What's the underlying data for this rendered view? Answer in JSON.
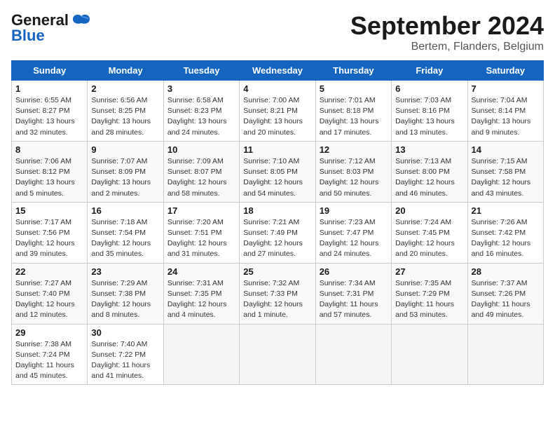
{
  "header": {
    "logo_line1": "General",
    "logo_line2": "Blue",
    "title": "September 2024",
    "subtitle": "Bertem, Flanders, Belgium"
  },
  "weekdays": [
    "Sunday",
    "Monday",
    "Tuesday",
    "Wednesday",
    "Thursday",
    "Friday",
    "Saturday"
  ],
  "weeks": [
    [
      {
        "day": 1,
        "info": "Sunrise: 6:55 AM\nSunset: 8:27 PM\nDaylight: 13 hours\nand 32 minutes."
      },
      {
        "day": 2,
        "info": "Sunrise: 6:56 AM\nSunset: 8:25 PM\nDaylight: 13 hours\nand 28 minutes."
      },
      {
        "day": 3,
        "info": "Sunrise: 6:58 AM\nSunset: 8:23 PM\nDaylight: 13 hours\nand 24 minutes."
      },
      {
        "day": 4,
        "info": "Sunrise: 7:00 AM\nSunset: 8:21 PM\nDaylight: 13 hours\nand 20 minutes."
      },
      {
        "day": 5,
        "info": "Sunrise: 7:01 AM\nSunset: 8:18 PM\nDaylight: 13 hours\nand 17 minutes."
      },
      {
        "day": 6,
        "info": "Sunrise: 7:03 AM\nSunset: 8:16 PM\nDaylight: 13 hours\nand 13 minutes."
      },
      {
        "day": 7,
        "info": "Sunrise: 7:04 AM\nSunset: 8:14 PM\nDaylight: 13 hours\nand 9 minutes."
      }
    ],
    [
      {
        "day": 8,
        "info": "Sunrise: 7:06 AM\nSunset: 8:12 PM\nDaylight: 13 hours\nand 5 minutes."
      },
      {
        "day": 9,
        "info": "Sunrise: 7:07 AM\nSunset: 8:09 PM\nDaylight: 13 hours\nand 2 minutes."
      },
      {
        "day": 10,
        "info": "Sunrise: 7:09 AM\nSunset: 8:07 PM\nDaylight: 12 hours\nand 58 minutes."
      },
      {
        "day": 11,
        "info": "Sunrise: 7:10 AM\nSunset: 8:05 PM\nDaylight: 12 hours\nand 54 minutes."
      },
      {
        "day": 12,
        "info": "Sunrise: 7:12 AM\nSunset: 8:03 PM\nDaylight: 12 hours\nand 50 minutes."
      },
      {
        "day": 13,
        "info": "Sunrise: 7:13 AM\nSunset: 8:00 PM\nDaylight: 12 hours\nand 46 minutes."
      },
      {
        "day": 14,
        "info": "Sunrise: 7:15 AM\nSunset: 7:58 PM\nDaylight: 12 hours\nand 43 minutes."
      }
    ],
    [
      {
        "day": 15,
        "info": "Sunrise: 7:17 AM\nSunset: 7:56 PM\nDaylight: 12 hours\nand 39 minutes."
      },
      {
        "day": 16,
        "info": "Sunrise: 7:18 AM\nSunset: 7:54 PM\nDaylight: 12 hours\nand 35 minutes."
      },
      {
        "day": 17,
        "info": "Sunrise: 7:20 AM\nSunset: 7:51 PM\nDaylight: 12 hours\nand 31 minutes."
      },
      {
        "day": 18,
        "info": "Sunrise: 7:21 AM\nSunset: 7:49 PM\nDaylight: 12 hours\nand 27 minutes."
      },
      {
        "day": 19,
        "info": "Sunrise: 7:23 AM\nSunset: 7:47 PM\nDaylight: 12 hours\nand 24 minutes."
      },
      {
        "day": 20,
        "info": "Sunrise: 7:24 AM\nSunset: 7:45 PM\nDaylight: 12 hours\nand 20 minutes."
      },
      {
        "day": 21,
        "info": "Sunrise: 7:26 AM\nSunset: 7:42 PM\nDaylight: 12 hours\nand 16 minutes."
      }
    ],
    [
      {
        "day": 22,
        "info": "Sunrise: 7:27 AM\nSunset: 7:40 PM\nDaylight: 12 hours\nand 12 minutes."
      },
      {
        "day": 23,
        "info": "Sunrise: 7:29 AM\nSunset: 7:38 PM\nDaylight: 12 hours\nand 8 minutes."
      },
      {
        "day": 24,
        "info": "Sunrise: 7:31 AM\nSunset: 7:35 PM\nDaylight: 12 hours\nand 4 minutes."
      },
      {
        "day": 25,
        "info": "Sunrise: 7:32 AM\nSunset: 7:33 PM\nDaylight: 12 hours\nand 1 minute."
      },
      {
        "day": 26,
        "info": "Sunrise: 7:34 AM\nSunset: 7:31 PM\nDaylight: 11 hours\nand 57 minutes."
      },
      {
        "day": 27,
        "info": "Sunrise: 7:35 AM\nSunset: 7:29 PM\nDaylight: 11 hours\nand 53 minutes."
      },
      {
        "day": 28,
        "info": "Sunrise: 7:37 AM\nSunset: 7:26 PM\nDaylight: 11 hours\nand 49 minutes."
      }
    ],
    [
      {
        "day": 29,
        "info": "Sunrise: 7:38 AM\nSunset: 7:24 PM\nDaylight: 11 hours\nand 45 minutes."
      },
      {
        "day": 30,
        "info": "Sunrise: 7:40 AM\nSunset: 7:22 PM\nDaylight: 11 hours\nand 41 minutes."
      },
      null,
      null,
      null,
      null,
      null
    ]
  ]
}
